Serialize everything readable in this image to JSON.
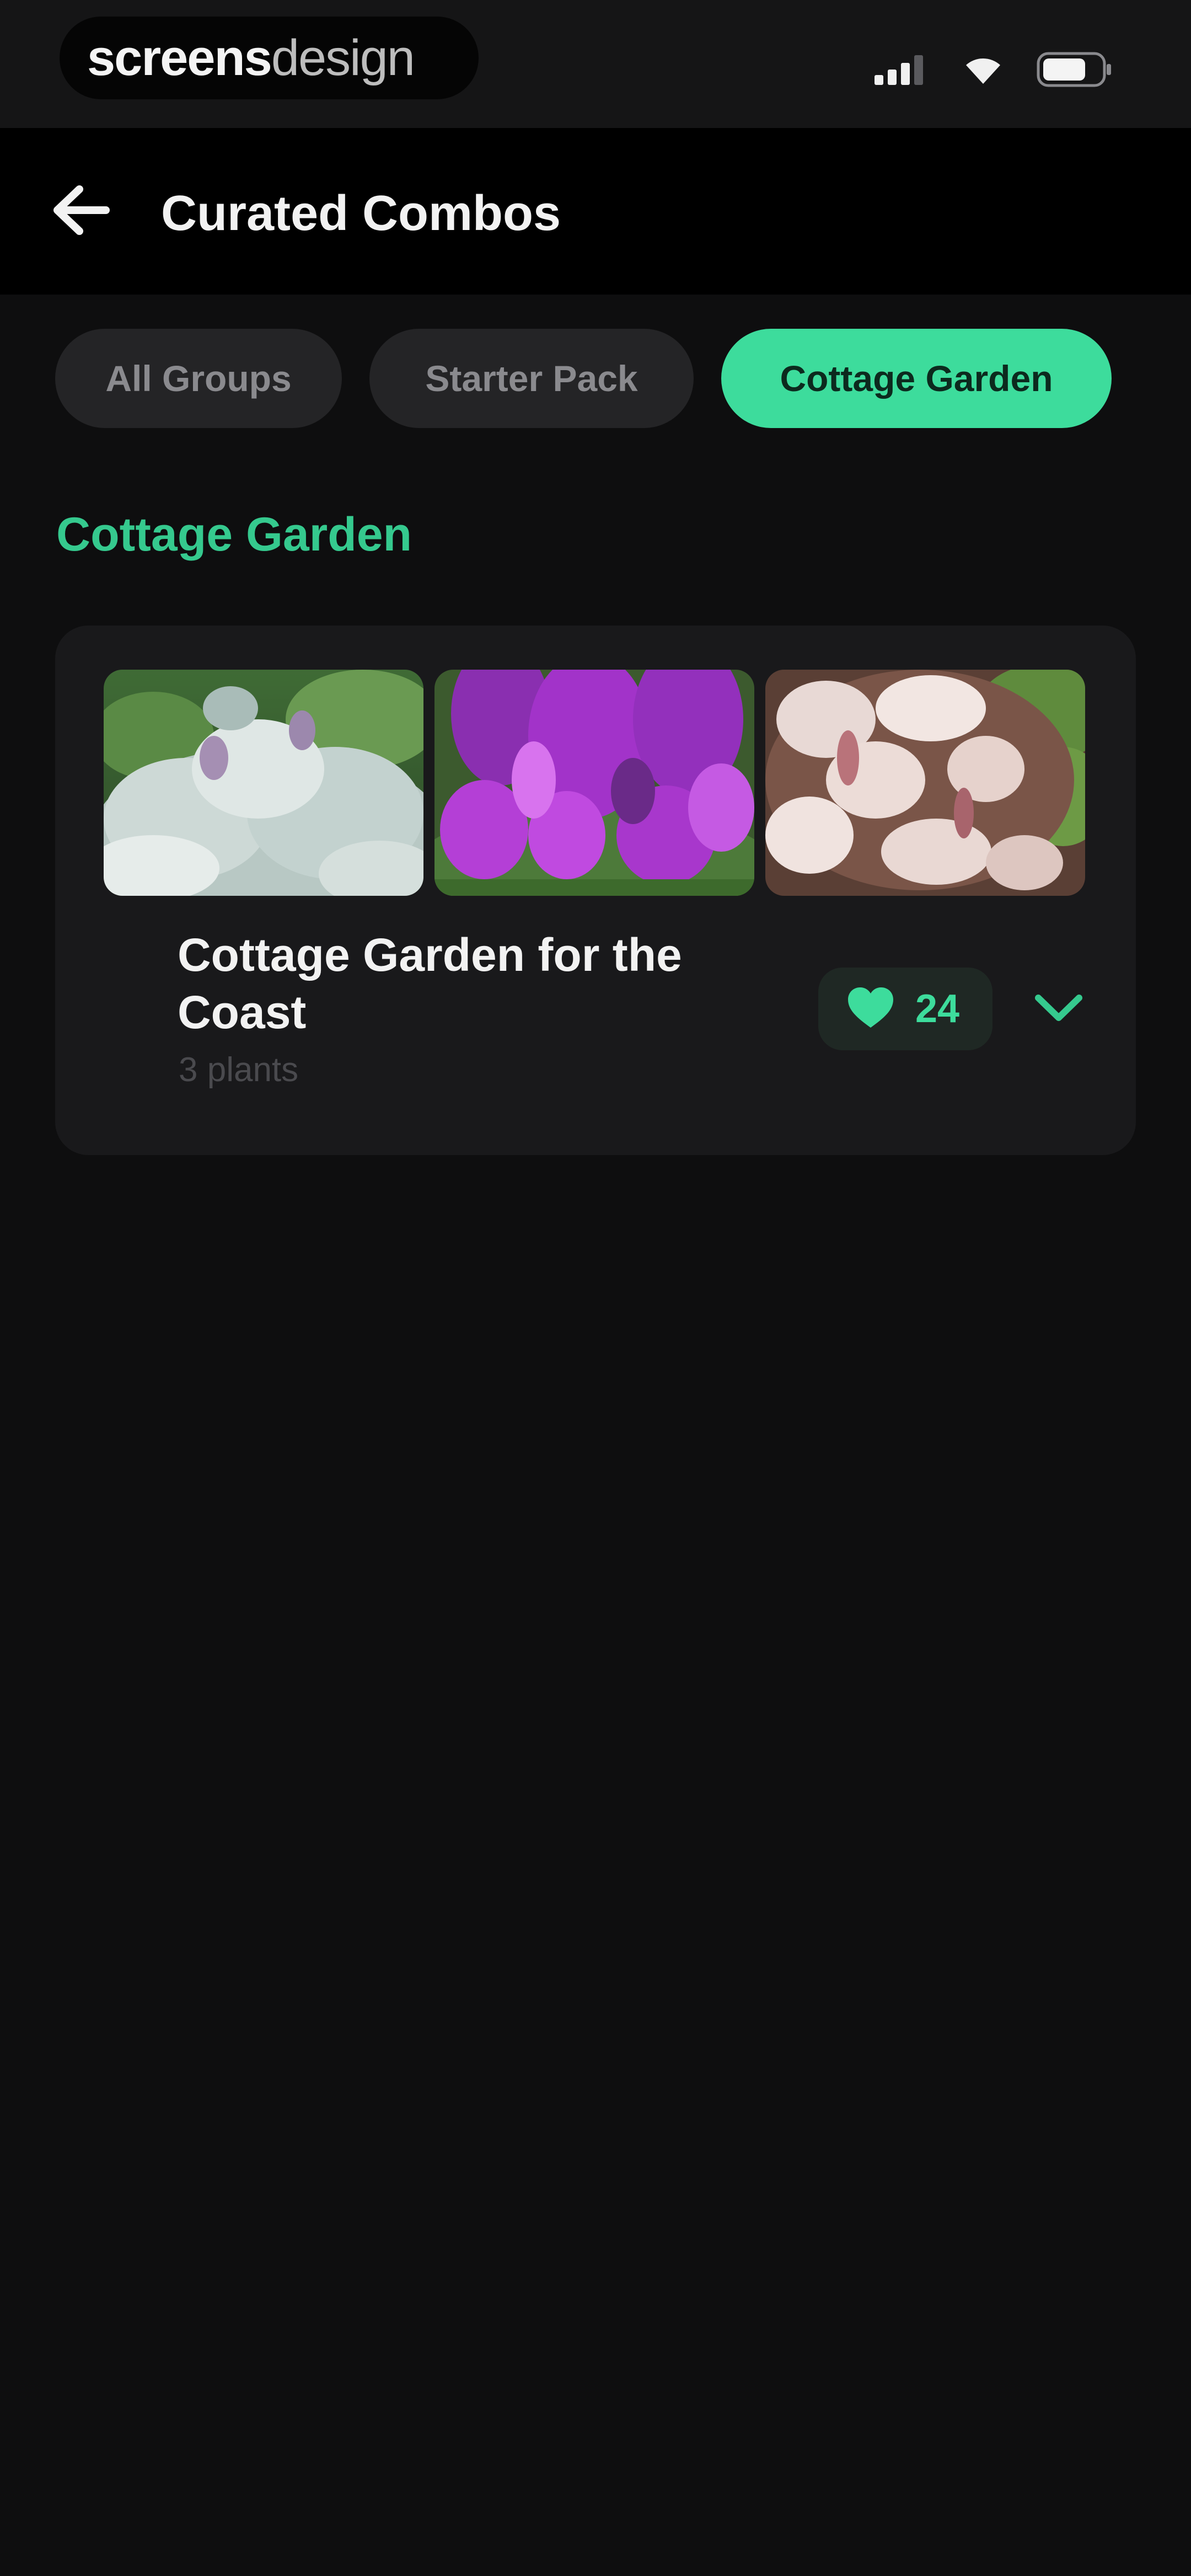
{
  "status_bar": {
    "brand_bold": "screens",
    "brand_light": "design"
  },
  "header": {
    "title": "Curated Combos"
  },
  "chips": [
    {
      "label": "All Groups",
      "active": false
    },
    {
      "label": "Starter Pack",
      "active": false
    },
    {
      "label": "Cottage Garden",
      "active": true
    }
  ],
  "section": {
    "heading": "Cottage Garden"
  },
  "card": {
    "title": "Cottage Garden for the Coast",
    "subtitle": "3 plants",
    "likes": "24",
    "images": [
      "lambs-ear",
      "foxglove",
      "gaura"
    ]
  },
  "colors": {
    "accent": "#3ddc9c",
    "heading_green": "#35c98e",
    "background": "#0e0e0f",
    "card": "#19191b"
  }
}
